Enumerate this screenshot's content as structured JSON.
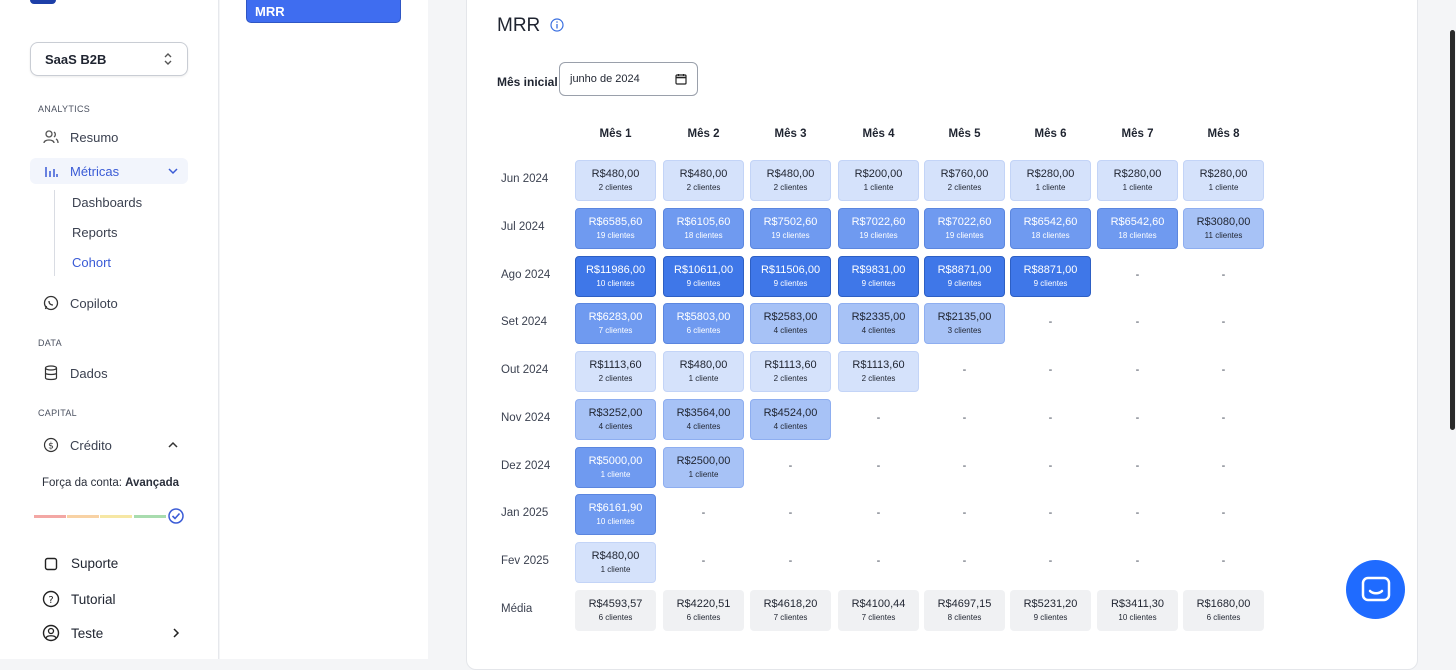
{
  "sidebar": {
    "workspace": "SaaS B2B",
    "sections": {
      "analytics": "ANALYTICS",
      "data": "DATA",
      "capital": "CAPITAL"
    },
    "items": {
      "resumo": "Resumo",
      "metricas": "Métricas",
      "copiloto": "Copiloto",
      "dados": "Dados",
      "credito": "Crédito"
    },
    "submenu": {
      "dashboards": "Dashboards",
      "reports": "Reports",
      "cohort": "Cohort"
    },
    "strength_label": "Força da conta:",
    "strength_value": "Avançada",
    "bottom": {
      "suporte": "Suporte",
      "tutorial": "Tutorial",
      "teste": "Teste"
    }
  },
  "tab": {
    "label": "MRR"
  },
  "main": {
    "title": "MRR",
    "date_label": "Mês inicial",
    "date_value": "junho de 2024"
  },
  "table": {
    "columns": [
      "Mês 1",
      "Mês 2",
      "Mês 3",
      "Mês 4",
      "Mês 5",
      "Mês 6",
      "Mês 7",
      "Mês 8"
    ],
    "rows": [
      {
        "label": "Jun 2024",
        "cells": [
          [
            "R$480,00",
            "2 clientes"
          ],
          [
            "R$480,00",
            "2 clientes"
          ],
          [
            "R$480,00",
            "2 clientes"
          ],
          [
            "R$200,00",
            "1 cliente"
          ],
          [
            "R$760,00",
            "2 clientes"
          ],
          [
            "R$280,00",
            "1 cliente"
          ],
          [
            "R$280,00",
            "1 cliente"
          ],
          [
            "R$280,00",
            "1 cliente"
          ]
        ]
      },
      {
        "label": "Jul 2024",
        "cells": [
          [
            "R$6585,60",
            "19 clientes"
          ],
          [
            "R$6105,60",
            "18 clientes"
          ],
          [
            "R$7502,60",
            "19 clientes"
          ],
          [
            "R$7022,60",
            "19 clientes"
          ],
          [
            "R$7022,60",
            "19 clientes"
          ],
          [
            "R$6542,60",
            "18 clientes"
          ],
          [
            "R$6542,60",
            "18 clientes"
          ],
          [
            "R$3080,00",
            "11 clientes"
          ]
        ]
      },
      {
        "label": "Ago 2024",
        "cells": [
          [
            "R$11986,00",
            "10 clientes"
          ],
          [
            "R$10611,00",
            "9 clientes"
          ],
          [
            "R$11506,00",
            "9 clientes"
          ],
          [
            "R$9831,00",
            "9 clientes"
          ],
          [
            "R$8871,00",
            "9 clientes"
          ],
          [
            "R$8871,00",
            "9 clientes"
          ],
          null,
          null
        ]
      },
      {
        "label": "Set 2024",
        "cells": [
          [
            "R$6283,00",
            "7 clientes"
          ],
          [
            "R$5803,00",
            "6 clientes"
          ],
          [
            "R$2583,00",
            "4 clientes"
          ],
          [
            "R$2335,00",
            "4 clientes"
          ],
          [
            "R$2135,00",
            "3 clientes"
          ],
          null,
          null,
          null
        ]
      },
      {
        "label": "Out 2024",
        "cells": [
          [
            "R$1113,60",
            "2 clientes"
          ],
          [
            "R$480,00",
            "1 cliente"
          ],
          [
            "R$1113,60",
            "2 clientes"
          ],
          [
            "R$1113,60",
            "2 clientes"
          ],
          null,
          null,
          null,
          null
        ]
      },
      {
        "label": "Nov 2024",
        "cells": [
          [
            "R$3252,00",
            "4 clientes"
          ],
          [
            "R$3564,00",
            "4 clientes"
          ],
          [
            "R$4524,00",
            "4 clientes"
          ],
          null,
          null,
          null,
          null,
          null
        ]
      },
      {
        "label": "Dez 2024",
        "cells": [
          [
            "R$5000,00",
            "1 cliente"
          ],
          [
            "R$2500,00",
            "1 cliente"
          ],
          null,
          null,
          null,
          null,
          null,
          null
        ]
      },
      {
        "label": "Jan 2025",
        "cells": [
          [
            "R$6161,90",
            "10 clientes"
          ],
          null,
          null,
          null,
          null,
          null,
          null,
          null
        ]
      },
      {
        "label": "Fev 2025",
        "cells": [
          [
            "R$480,00",
            "1 cliente"
          ],
          null,
          null,
          null,
          null,
          null,
          null,
          null
        ]
      }
    ],
    "average": {
      "label": "Média",
      "cells": [
        [
          "R$4593,57",
          "6 clientes"
        ],
        [
          "R$4220,51",
          "6 clientes"
        ],
        [
          "R$4618,20",
          "7 clientes"
        ],
        [
          "R$4100,44",
          "7 clientes"
        ],
        [
          "R$4697,15",
          "8 clientes"
        ],
        [
          "R$5231,20",
          "9 clientes"
        ],
        [
          "R$3411,30",
          "10 clientes"
        ],
        [
          "R$1680,00",
          "6 clientes"
        ]
      ]
    },
    "empty_marker": "-"
  },
  "colors": {
    "accent": "#3a5bd6",
    "tab": "#3f6df0",
    "chat": "#1f6bff",
    "avg_cell": "#f0f1f3"
  }
}
